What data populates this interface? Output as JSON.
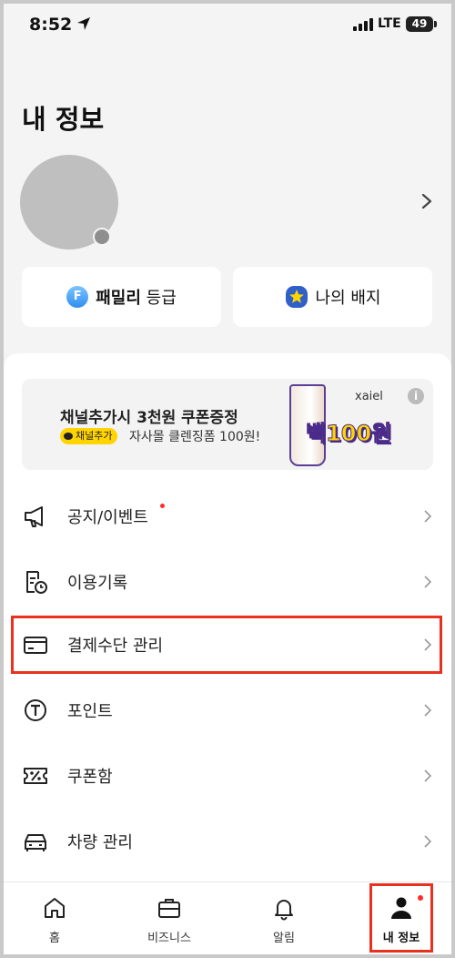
{
  "status_bar": {
    "time": "8:52",
    "network": "LTE",
    "battery": "49"
  },
  "header": {
    "title": "내 정보"
  },
  "chips": [
    {
      "icon_text": "F",
      "bold": "패밀리",
      "label": " 등급",
      "icon": "family-grade-icon"
    },
    {
      "label": "나의 배지",
      "icon": "star-badge-icon"
    }
  ],
  "banner": {
    "title": "채널추가시 3천원 쿠폰증정",
    "pill": "채널추가",
    "subtitle": "자사몰 클렌징폼 100원!",
    "brand": "xaiel",
    "promo": "백100원"
  },
  "menu": [
    {
      "label": "공지/이벤트",
      "icon": "megaphone-icon",
      "new": true
    },
    {
      "label": "이용기록",
      "icon": "history-clock-icon",
      "new": false
    },
    {
      "label": "결제수단 관리",
      "icon": "credit-card-icon",
      "new": false
    },
    {
      "label": "포인트",
      "icon": "point-coin-icon",
      "new": false
    },
    {
      "label": "쿠폰함",
      "icon": "coupon-icon",
      "new": false
    },
    {
      "label": "차량 관리",
      "icon": "car-icon",
      "new": false
    }
  ],
  "tabs": [
    {
      "label": "홈",
      "icon": "home-icon"
    },
    {
      "label": "비즈니스",
      "icon": "briefcase-icon"
    },
    {
      "label": "알림",
      "icon": "bell-icon"
    },
    {
      "label": "내 정보",
      "icon": "person-icon",
      "active": true
    }
  ],
  "colors": {
    "accent_red": "#ff2b2b",
    "highlight": "#e8321f",
    "kakao_yellow": "#ffd400"
  }
}
